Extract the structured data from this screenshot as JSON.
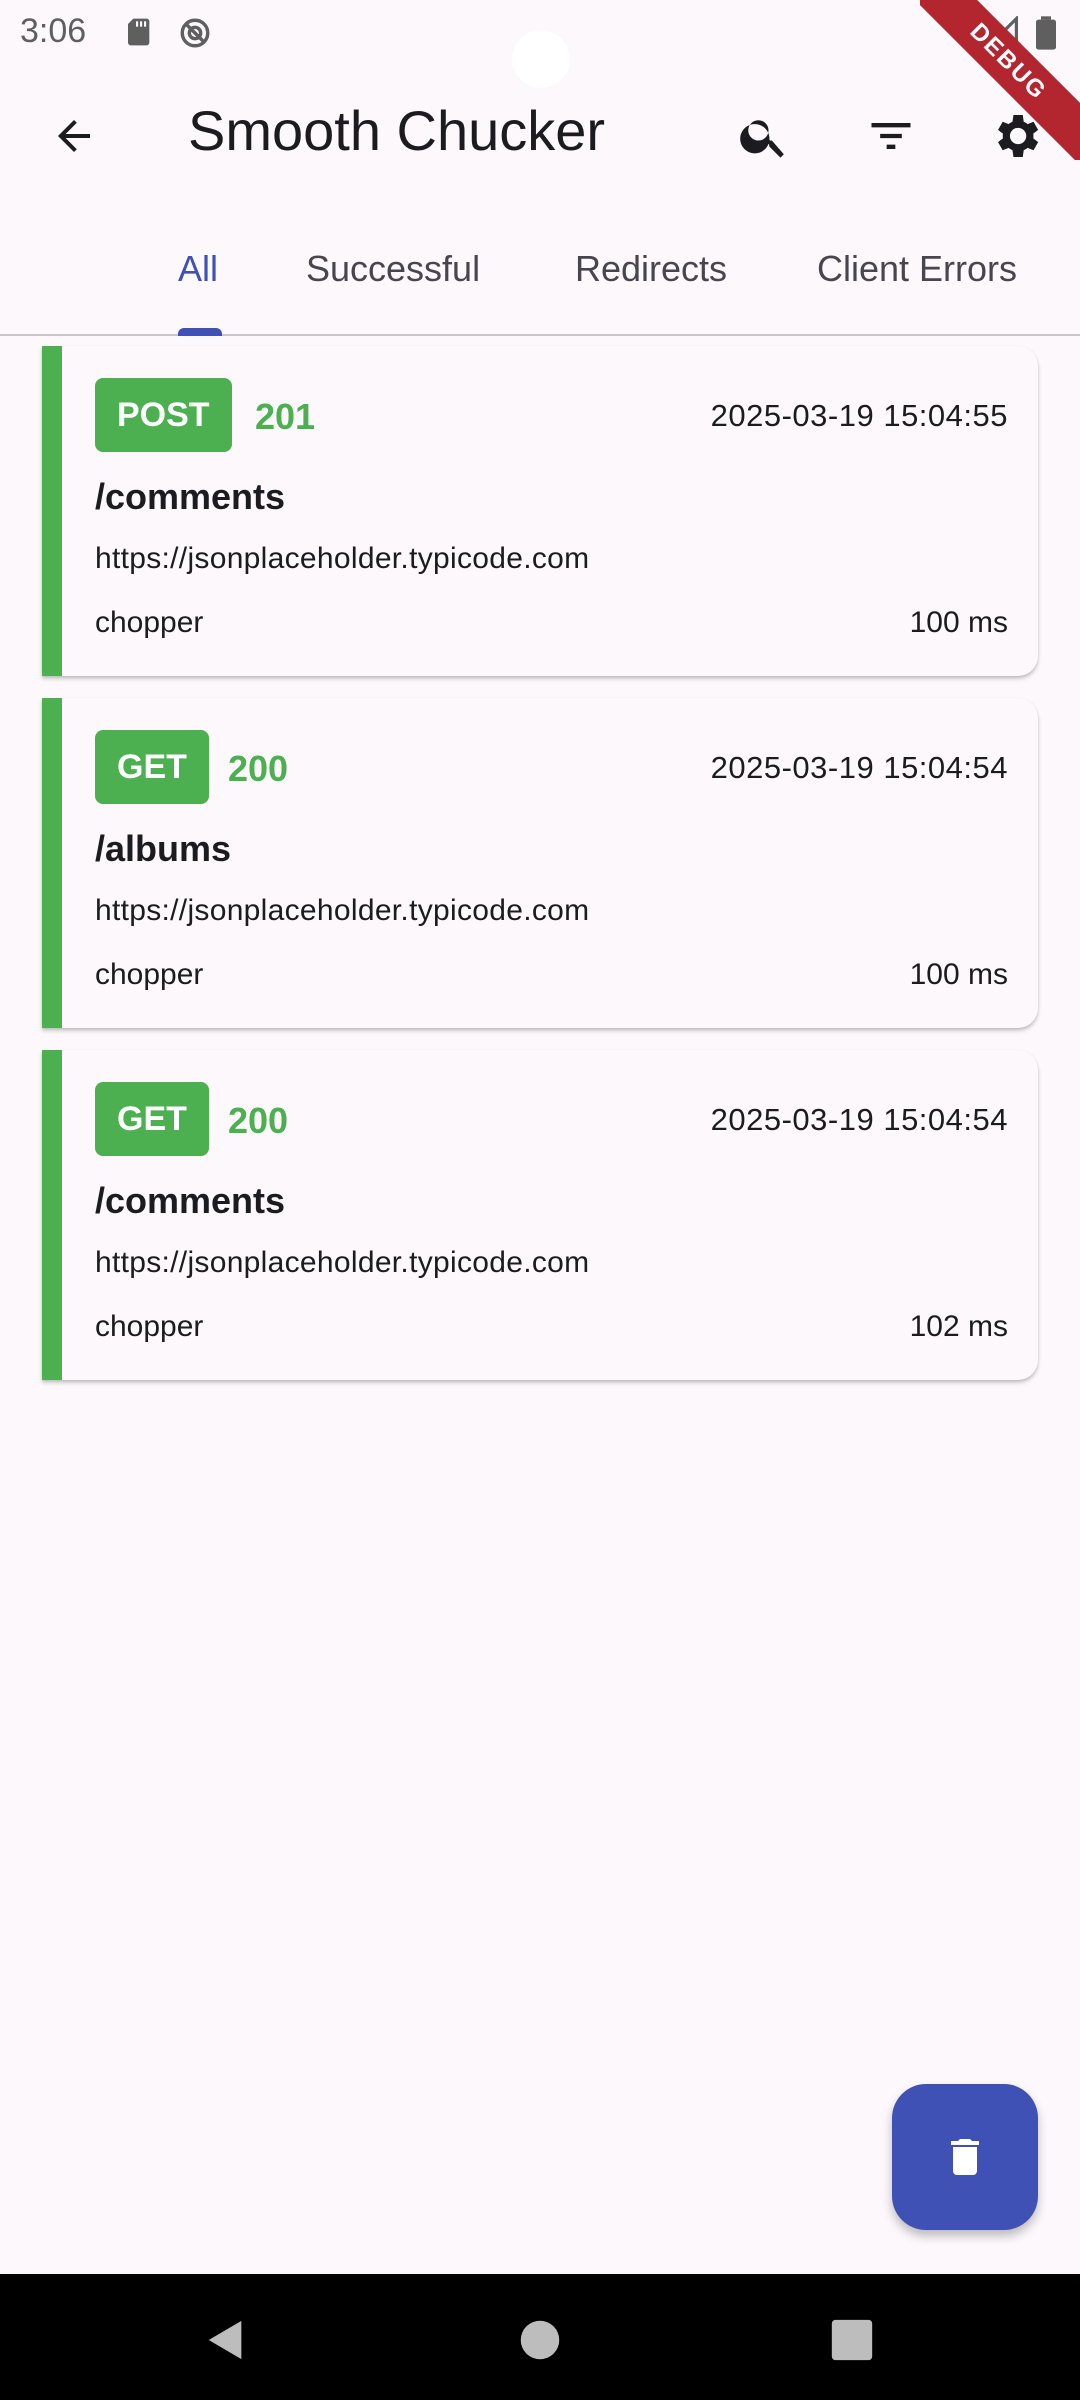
{
  "status_bar": {
    "time": "3:06",
    "icons": [
      "sd-card-icon",
      "do-not-disturb-icon",
      "wifi-icon",
      "signal-icon",
      "battery-icon"
    ]
  },
  "debug_banner": {
    "label": "DEBUG"
  },
  "app_bar": {
    "title": "Smooth Chucker",
    "icons": [
      "back-arrow-icon",
      "search-icon",
      "filter-icon",
      "gear-icon"
    ]
  },
  "tabs": [
    {
      "label": "All",
      "active": true
    },
    {
      "label": "Successful",
      "active": false
    },
    {
      "label": "Redirects",
      "active": false
    },
    {
      "label": "Client Errors",
      "active": false
    }
  ],
  "requests": [
    {
      "method": "POST",
      "status": "201",
      "timestamp": "2025-03-19 15:04:55",
      "path": "/comments",
      "host": "https://jsonplaceholder.typicode.com",
      "client": "chopper",
      "duration": "100 ms"
    },
    {
      "method": "GET",
      "status": "200",
      "timestamp": "2025-03-19 15:04:54",
      "path": "/albums",
      "host": "https://jsonplaceholder.typicode.com",
      "client": "chopper",
      "duration": "100 ms"
    },
    {
      "method": "GET",
      "status": "200",
      "timestamp": "2025-03-19 15:04:54",
      "path": "/comments",
      "host": "https://jsonplaceholder.typicode.com",
      "client": "chopper",
      "duration": "102 ms"
    }
  ],
  "fab": {
    "icon": "delete-icon"
  },
  "nav_bar": {
    "icons": [
      "nav-back-icon",
      "nav-home-icon",
      "nav-recents-icon"
    ]
  },
  "colors": {
    "primary": "#3f51b5",
    "success": "#4caf50",
    "debug": "#b3262f",
    "background": "#fcf8fc"
  }
}
